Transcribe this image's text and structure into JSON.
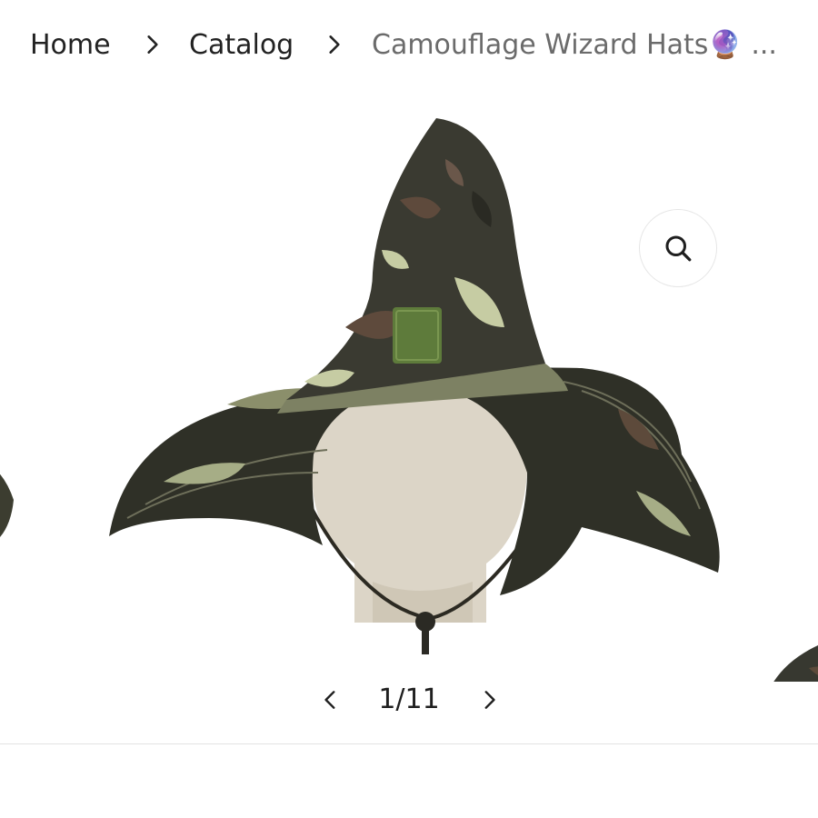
{
  "breadcrumb": {
    "home": "Home",
    "catalog": "Catalog",
    "current": "Camouflage Wizard Hats🔮 ..."
  },
  "gallery": {
    "image_icon": "camouflage-wizard-hat-on-mannequin",
    "zoom_icon": "search-icon",
    "current": 1,
    "total": 11,
    "counter": "1/11"
  },
  "colors": {
    "text": "#1f1f1f",
    "muted": "#6b6b6b",
    "divider": "#e3e3e3"
  }
}
